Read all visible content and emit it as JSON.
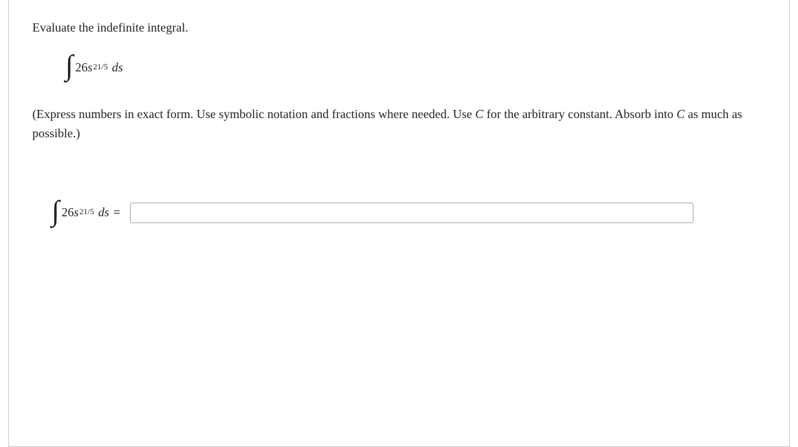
{
  "question": {
    "prompt": "Evaluate the indefinite integral.",
    "integral": {
      "coefficient": "26",
      "variable": "s",
      "exponent": "21/5",
      "differential": "ds"
    },
    "instructions_pre": "(Express numbers in exact form. Use symbolic notation and fractions where needed. Use ",
    "instructions_c1": "C",
    "instructions_mid": " for the arbitrary constant. Absorb into ",
    "instructions_c2": "C",
    "instructions_post": " as much as possible.)"
  },
  "answer": {
    "equals": "=",
    "input_value": ""
  }
}
